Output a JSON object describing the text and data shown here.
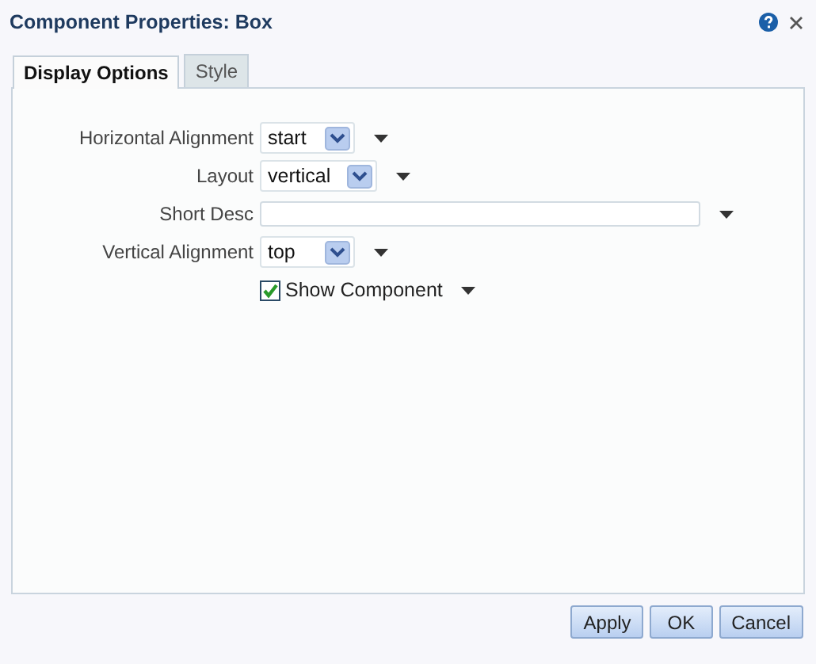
{
  "window": {
    "title": "Component Properties: Box"
  },
  "tabs": [
    {
      "label": "Display Options",
      "selected": true
    },
    {
      "label": "Style",
      "selected": false
    }
  ],
  "fields": [
    {
      "kind": "select",
      "label": "Horizontal Alignment",
      "value": "start"
    },
    {
      "kind": "select",
      "label": "Layout",
      "value": "vertical"
    },
    {
      "kind": "text",
      "label": "Short Desc"
    },
    {
      "kind": "select",
      "label": "Vertical Alignment",
      "value": "top"
    },
    {
      "kind": "checkbox",
      "label": "Show Component",
      "checked": true
    }
  ],
  "buttons": [
    "Apply",
    "OK",
    "Cancel"
  ]
}
